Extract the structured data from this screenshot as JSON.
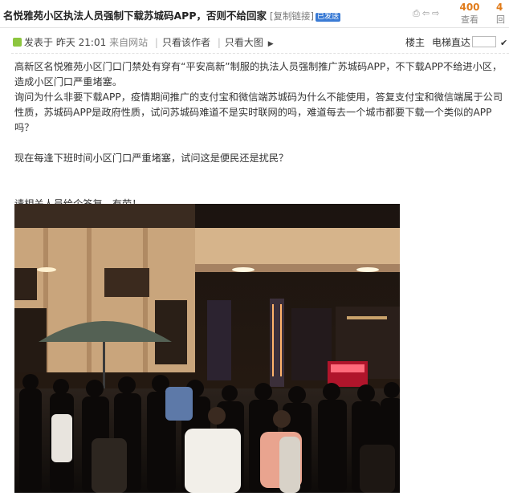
{
  "thread": {
    "title": "名悦雅苑小区执法人员强制下载苏城码APP，否则不给回家",
    "copy_link": "[复制链接]",
    "badge": "已发送",
    "views_count": "400",
    "views_label": "查看",
    "replies_count": "4",
    "replies_label": "回"
  },
  "post": {
    "posted_label": "发表于",
    "time": "昨天 21:01",
    "source": "来自网站",
    "only_author": "只看该作者",
    "view_large": "只看大图",
    "floor": "楼主",
    "elevator": "电梯直达"
  },
  "content": {
    "p1": "高新区名悦雅苑小区门口门禁处有穿有“平安高新”制服的执法人员强制推广苏城码APP，不下载APP不给进小区，造成小区门口严重堵塞。",
    "p2": "询问为什么非要下载APP，疫情期间推广的支付宝和微信端苏城码为什么不能使用，答复支付宝和微信端属于公司性质，苏城码APP是政府性质，试问苏城码难道不是实时联网的吗，难道每去一个城市都要下载一个类似的APP吗？",
    "p3": "现在每逢下班时间小区门口严重堵塞，试问这是便民还是扰民？",
    "p4": "请相关人员给个答复，有劳！"
  },
  "colors": {
    "stat_orange": "#e07b1a",
    "badge_blue": "#3a7bd5",
    "post_icon_green": "#8dc63f"
  },
  "icons": [
    "print-icon",
    "prev-thread-icon",
    "next-thread-icon",
    "post-icon",
    "arrow-right-icon",
    "go-icon"
  ]
}
